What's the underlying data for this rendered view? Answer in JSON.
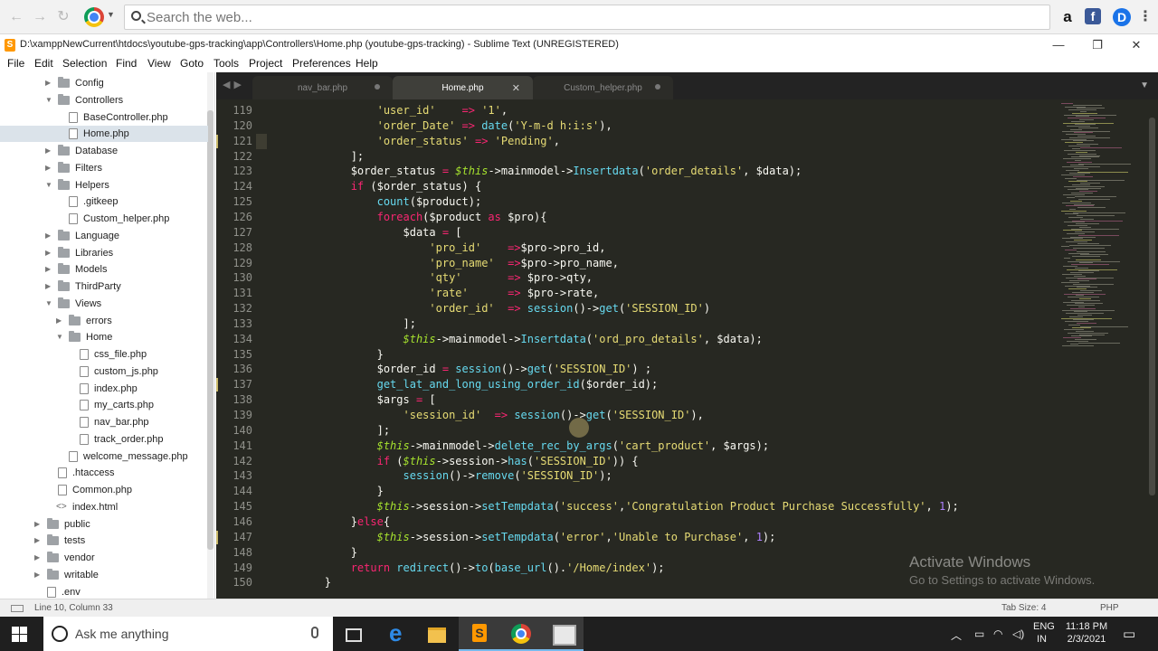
{
  "browser": {
    "search_placeholder": "Search the web...",
    "ext_amazon": "a",
    "ext_facebook": "f",
    "ext_profile": "D",
    "ext_more": "⋮"
  },
  "window": {
    "title": "D:\\xamppNewCurrent\\htdocs\\youtube-gps-tracking\\app\\Controllers\\Home.php (youtube-gps-tracking) - Sublime Text (UNREGISTERED)",
    "minimize": "—",
    "maximize": "❐",
    "close": "✕"
  },
  "menu": [
    "File",
    "Edit",
    "Selection",
    "Find",
    "View",
    "Goto",
    "Tools",
    "Project",
    "Preferences",
    "Help"
  ],
  "sidebar": [
    {
      "label": "Config",
      "type": "folder",
      "depth": 1,
      "open": false
    },
    {
      "label": "Controllers",
      "type": "folder",
      "depth": 1,
      "open": true
    },
    {
      "label": "BaseController.php",
      "type": "file",
      "depth": 2
    },
    {
      "label": "Home.php",
      "type": "file",
      "depth": 2,
      "selected": true
    },
    {
      "label": "Database",
      "type": "folder",
      "depth": 1,
      "open": false
    },
    {
      "label": "Filters",
      "type": "folder",
      "depth": 1,
      "open": false
    },
    {
      "label": "Helpers",
      "type": "folder",
      "depth": 1,
      "open": true
    },
    {
      "label": ".gitkeep",
      "type": "file",
      "depth": 2
    },
    {
      "label": "Custom_helper.php",
      "type": "file",
      "depth": 2
    },
    {
      "label": "Language",
      "type": "folder",
      "depth": 1,
      "open": false
    },
    {
      "label": "Libraries",
      "type": "folder",
      "depth": 1,
      "open": false
    },
    {
      "label": "Models",
      "type": "folder",
      "depth": 1,
      "open": false
    },
    {
      "label": "ThirdParty",
      "type": "folder",
      "depth": 1,
      "open": false
    },
    {
      "label": "Views",
      "type": "folder",
      "depth": 1,
      "open": true
    },
    {
      "label": "errors",
      "type": "folder",
      "depth": 2,
      "open": false
    },
    {
      "label": "Home",
      "type": "folder",
      "depth": 2,
      "open": true
    },
    {
      "label": "css_file.php",
      "type": "file",
      "depth": 3
    },
    {
      "label": "custom_js.php",
      "type": "file",
      "depth": 3
    },
    {
      "label": "index.php",
      "type": "file",
      "depth": 3
    },
    {
      "label": "my_carts.php",
      "type": "file",
      "depth": 3
    },
    {
      "label": "nav_bar.php",
      "type": "file",
      "depth": 3
    },
    {
      "label": "track_order.php",
      "type": "file",
      "depth": 3
    },
    {
      "label": "welcome_message.php",
      "type": "file",
      "depth": 2
    },
    {
      "label": ".htaccess",
      "type": "file",
      "depth": 1
    },
    {
      "label": "Common.php",
      "type": "file",
      "depth": 1
    },
    {
      "label": "index.html",
      "type": "code",
      "depth": 1
    },
    {
      "label": "public",
      "type": "folder",
      "depth": 0,
      "open": false
    },
    {
      "label": "tests",
      "type": "folder",
      "depth": 0,
      "open": false
    },
    {
      "label": "vendor",
      "type": "folder",
      "depth": 0,
      "open": false
    },
    {
      "label": "writable",
      "type": "folder",
      "depth": 0,
      "open": false
    },
    {
      "label": ".env",
      "type": "file",
      "depth": 0
    }
  ],
  "tabs": [
    {
      "label": "nav_bar.php",
      "active": false
    },
    {
      "label": "Home.php",
      "active": true,
      "close": "✕"
    },
    {
      "label": "Custom_helper.php",
      "active": false
    }
  ],
  "editor": {
    "current_line": 121,
    "lines": [
      {
        "n": "119",
        "t": [
          [
            "s",
            "                'user_id'"
          ],
          [
            "o",
            "    =>"
          ],
          [
            "s",
            " '1'"
          ],
          [
            "p",
            ","
          ]
        ]
      },
      {
        "n": "120",
        "t": [
          [
            "s",
            "                'order_Date'"
          ],
          [
            "o",
            " =>"
          ],
          [
            "f",
            " date"
          ],
          [
            "p",
            "("
          ],
          [
            "s",
            "'Y-m-d h:i:s'"
          ],
          [
            "p",
            "),"
          ]
        ]
      },
      {
        "n": "121",
        "t": [
          [
            "s",
            "                'order_status'"
          ],
          [
            "o",
            " =>"
          ],
          [
            "s",
            " 'Pending'"
          ],
          [
            "p",
            ","
          ]
        ]
      },
      {
        "n": "122",
        "t": [
          [
            "p",
            "            ];"
          ]
        ]
      },
      {
        "n": "123",
        "t": [
          [
            "p",
            "            $order_status "
          ],
          [
            "o",
            "="
          ],
          [
            "v",
            " $this"
          ],
          [
            "p",
            "->mainmodel->"
          ],
          [
            "f",
            "Insertdata"
          ],
          [
            "p",
            "("
          ],
          [
            "s",
            "'order_details'"
          ],
          [
            "p",
            ", $data);"
          ]
        ]
      },
      {
        "n": "124",
        "t": [
          [
            "k",
            "            if"
          ],
          [
            "p",
            " ($order_status) {"
          ]
        ]
      },
      {
        "n": "125",
        "t": [
          [
            "f",
            "                count"
          ],
          [
            "p",
            "($product);"
          ]
        ]
      },
      {
        "n": "126",
        "t": [
          [
            "k",
            "                foreach"
          ],
          [
            "p",
            "($product "
          ],
          [
            "k",
            "as"
          ],
          [
            "p",
            " $pro){"
          ]
        ]
      },
      {
        "n": "127",
        "t": [
          [
            "p",
            "                    $data "
          ],
          [
            "o",
            "="
          ],
          [
            "p",
            " ["
          ]
        ]
      },
      {
        "n": "128",
        "t": [
          [
            "s",
            "                        'pro_id'"
          ],
          [
            "o",
            "    =>"
          ],
          [
            "p",
            "$pro->pro_id,"
          ]
        ]
      },
      {
        "n": "129",
        "t": [
          [
            "s",
            "                        'pro_name'"
          ],
          [
            "o",
            "  =>"
          ],
          [
            "p",
            "$pro->pro_name,"
          ]
        ]
      },
      {
        "n": "130",
        "t": [
          [
            "s",
            "                        'qty'"
          ],
          [
            "o",
            "       =>"
          ],
          [
            "p",
            " $pro->qty,"
          ]
        ]
      },
      {
        "n": "131",
        "t": [
          [
            "s",
            "                        'rate'"
          ],
          [
            "o",
            "      =>"
          ],
          [
            "p",
            " $pro->rate,"
          ]
        ]
      },
      {
        "n": "132",
        "t": [
          [
            "s",
            "                        'order_id'"
          ],
          [
            "o",
            "  =>"
          ],
          [
            "f",
            " session"
          ],
          [
            "p",
            "()->"
          ],
          [
            "f",
            "get"
          ],
          [
            "p",
            "("
          ],
          [
            "s",
            "'SESSION_ID'"
          ],
          [
            "p",
            ")"
          ]
        ]
      },
      {
        "n": "133",
        "t": [
          [
            "p",
            "                    ];"
          ]
        ]
      },
      {
        "n": "134",
        "t": [
          [
            "v",
            "                    $this"
          ],
          [
            "p",
            "->mainmodel->"
          ],
          [
            "f",
            "Insertdata"
          ],
          [
            "p",
            "("
          ],
          [
            "s",
            "'ord_pro_details'"
          ],
          [
            "p",
            ", $data);"
          ]
        ]
      },
      {
        "n": "135",
        "t": [
          [
            "p",
            "                }"
          ]
        ]
      },
      {
        "n": "136",
        "t": [
          [
            "p",
            "                $order_id "
          ],
          [
            "o",
            "="
          ],
          [
            "f",
            " session"
          ],
          [
            "p",
            "()->"
          ],
          [
            "f",
            "get"
          ],
          [
            "p",
            "("
          ],
          [
            "s",
            "'SESSION_ID'"
          ],
          [
            "p",
            ") ;"
          ]
        ]
      },
      {
        "n": "137",
        "t": [
          [
            "f",
            "                get_lat_and_long_using_order_id"
          ],
          [
            "p",
            "($order_id);"
          ]
        ]
      },
      {
        "n": "138",
        "t": [
          [
            "p",
            "                $args "
          ],
          [
            "o",
            "="
          ],
          [
            "p",
            " ["
          ]
        ]
      },
      {
        "n": "139",
        "t": [
          [
            "s",
            "                    'session_id'"
          ],
          [
            "o",
            "  =>"
          ],
          [
            "f",
            " session"
          ],
          [
            "p",
            "()->"
          ],
          [
            "f",
            "get"
          ],
          [
            "p",
            "("
          ],
          [
            "s",
            "'SESSION_ID'"
          ],
          [
            "p",
            "),"
          ]
        ]
      },
      {
        "n": "140",
        "t": [
          [
            "p",
            "                ];"
          ]
        ]
      },
      {
        "n": "141",
        "t": [
          [
            "v",
            "                $this"
          ],
          [
            "p",
            "->mainmodel->"
          ],
          [
            "f",
            "delete_rec_by_args"
          ],
          [
            "p",
            "("
          ],
          [
            "s",
            "'cart_product'"
          ],
          [
            "p",
            ", $args);"
          ]
        ]
      },
      {
        "n": "142",
        "t": [
          [
            "k",
            "                if"
          ],
          [
            "p",
            " ("
          ],
          [
            "v",
            "$this"
          ],
          [
            "p",
            "->session->"
          ],
          [
            "f",
            "has"
          ],
          [
            "p",
            "("
          ],
          [
            "s",
            "'SESSION_ID'"
          ],
          [
            "p",
            ")) {"
          ]
        ]
      },
      {
        "n": "143",
        "t": [
          [
            "f",
            "                    session"
          ],
          [
            "p",
            "()->"
          ],
          [
            "f",
            "remove"
          ],
          [
            "p",
            "("
          ],
          [
            "s",
            "'SESSION_ID'"
          ],
          [
            "p",
            ");"
          ]
        ]
      },
      {
        "n": "144",
        "t": [
          [
            "p",
            "                }"
          ]
        ]
      },
      {
        "n": "145",
        "t": [
          [
            "v",
            "                $this"
          ],
          [
            "p",
            "->session->"
          ],
          [
            "f",
            "setTempdata"
          ],
          [
            "p",
            "("
          ],
          [
            "s",
            "'success'"
          ],
          [
            "p",
            ","
          ],
          [
            "s",
            "'Congratulation Product Purchase Successfully'"
          ],
          [
            "p",
            ", "
          ],
          [
            "n",
            "1"
          ],
          [
            "p",
            ");"
          ]
        ]
      },
      {
        "n": "146",
        "t": [
          [
            "p",
            "            }"
          ],
          [
            "k",
            "else"
          ],
          [
            "p",
            "{"
          ]
        ]
      },
      {
        "n": "147",
        "t": [
          [
            "v",
            "                $this"
          ],
          [
            "p",
            "->session->"
          ],
          [
            "f",
            "setTempdata"
          ],
          [
            "p",
            "("
          ],
          [
            "s",
            "'error'"
          ],
          [
            "p",
            ","
          ],
          [
            "s",
            "'Unable to Purchase'"
          ],
          [
            "p",
            ", "
          ],
          [
            "n",
            "1"
          ],
          [
            "p",
            ");"
          ]
        ]
      },
      {
        "n": "148",
        "t": [
          [
            "p",
            "            }"
          ]
        ]
      },
      {
        "n": "149",
        "t": [
          [
            "k",
            "            return"
          ],
          [
            "f",
            " redirect"
          ],
          [
            "p",
            "()->"
          ],
          [
            "f",
            "to"
          ],
          [
            "p",
            "("
          ],
          [
            "f",
            "base_url"
          ],
          [
            "p",
            "()."
          ],
          [
            "s",
            "'/Home/index'"
          ],
          [
            "p",
            ");"
          ]
        ]
      },
      {
        "n": "150",
        "t": [
          [
            "p",
            "        }"
          ]
        ]
      }
    ]
  },
  "watermark": {
    "line1": "Activate Windows",
    "line2": "Go to Settings to activate Windows."
  },
  "status": {
    "position": "Line 10, Column 33",
    "tab_size": "Tab Size: 4",
    "syntax": "PHP"
  },
  "taskbar": {
    "search_placeholder": "Ask me anything",
    "language": "ENG",
    "region": "IN",
    "time": "11:18 PM",
    "date": "2/3/2021"
  }
}
